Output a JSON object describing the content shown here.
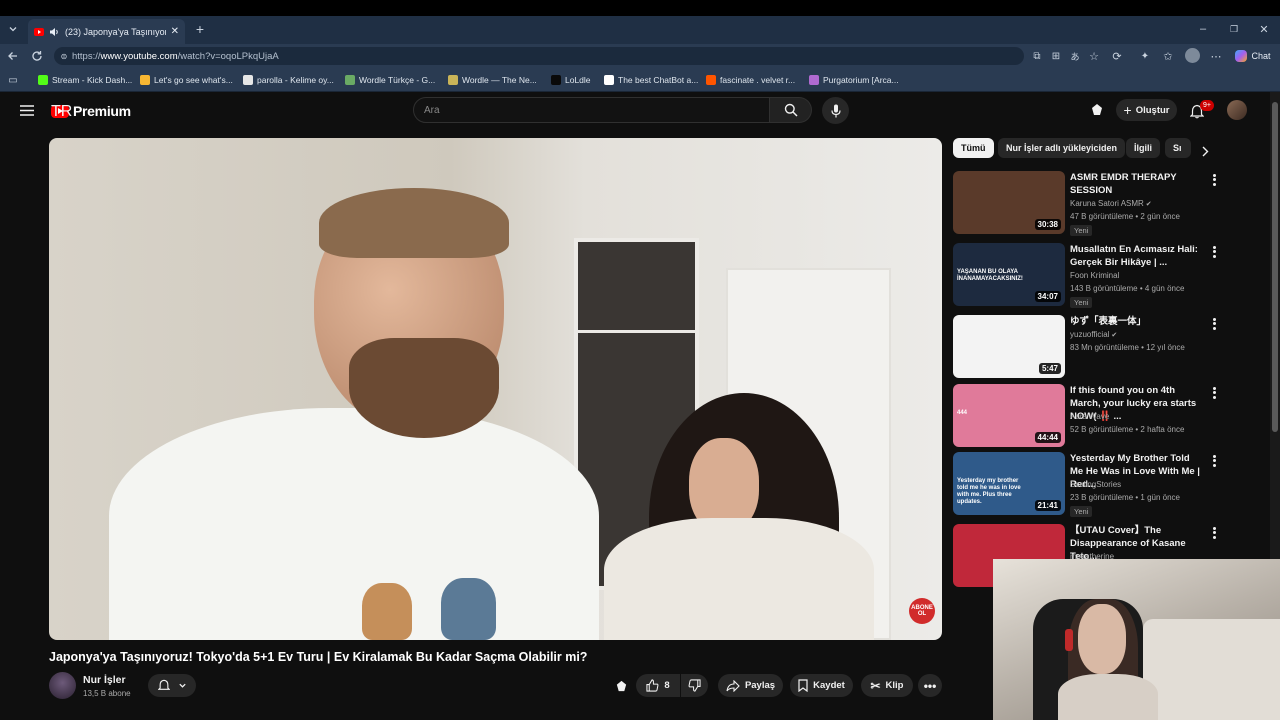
{
  "browser": {
    "tab_title": "(23) Japonya'ya Taşınıyoruz! T",
    "url_prefix": "https://",
    "url_host": "www.youtube.com",
    "url_path": "/watch?v=oqoLPkqUjaA",
    "chat_label": "Chat",
    "bookmarks": [
      {
        "label": "Stream - Kick Dash...",
        "icon": "kick-icon",
        "color": "#53fc18"
      },
      {
        "label": "Let's go see what's...",
        "icon": "smiley-icon",
        "color": "#f7b733"
      },
      {
        "label": "parolla - Kelime oy...",
        "icon": "circle-icon",
        "color": "#e6e6e6"
      },
      {
        "label": "Wordle Türkçe - G...",
        "icon": "wordle-w-icon",
        "color": "#6aaa64"
      },
      {
        "label": "Wordle — The Ne...",
        "icon": "grid-icon",
        "color": "#c9b458"
      },
      {
        "label": "LoLdle",
        "icon": "loldle-icon",
        "color": "#0a0a0a"
      },
      {
        "label": "The best ChatBot a...",
        "icon": "chatbot-icon",
        "color": "#ffffff"
      },
      {
        "label": "fascinate . velvet r...",
        "icon": "soundcloud-icon",
        "color": "#ff5500"
      },
      {
        "label": "Purgatorium [Arca...",
        "icon": "purgatorium-icon",
        "color": "#b06ad0"
      }
    ]
  },
  "youtube": {
    "logo_text": "Premium",
    "logo_region": "TR",
    "search_placeholder": "Ara",
    "create_label": "Oluştur",
    "notification_count": "9+",
    "video": {
      "title": "Japonya'ya Taşınıyoruz! Tokyo'da 5+1 Ev Turu | Ev Kiralamak Bu Kadar Saçma Olabilir mi?",
      "watermark": "ABONE OL",
      "channel_name": "Nur İşler",
      "subscribers": "13,5 B abone",
      "likes": "8",
      "share_label": "Paylaş",
      "save_label": "Kaydet",
      "clip_label": "Klip"
    },
    "chips": [
      "Tümü",
      "Nur İşler adlı yükleyiciden",
      "İlgili",
      "Sı"
    ],
    "recommendations": [
      {
        "title": "ASMR EMDR THERAPY SESSION",
        "channel": "Karuna Satori ASMR",
        "verified": true,
        "meta": "47 B görüntüleme • 2 gün önce",
        "badge": "Yeni",
        "duration": "30:38",
        "thumb_color": "#5a3a2a"
      },
      {
        "title": "Musallatın En Acımasız Hali: Gerçek Bir Hikâye | ...",
        "channel": "Foon Kriminal",
        "verified": false,
        "meta": "143 B görüntüleme • 4 gün önce",
        "badge": "Yeni",
        "duration": "34:07",
        "thumb_color": "#1d2a3f",
        "thumb_text": "YAŞANAN BU OLAYA İNANAMAYACAKSINIZ!"
      },
      {
        "title": "ゆず「表裏一体」",
        "channel": "yuzuofficial",
        "verified": true,
        "meta": "83 Mn görüntüleme • 12 yıl önce",
        "badge": "",
        "duration": "5:47",
        "thumb_color": "#f3f3f3"
      },
      {
        "title": "If this found you on 4th March, your lucky era starts NOW( ‼️ ...",
        "channel": "Aura Wave",
        "verified": false,
        "meta": "52 B görüntüleme • 2 hafta önce",
        "badge": "",
        "duration": "44:44",
        "thumb_color": "#e07a9a",
        "thumb_text": "444"
      },
      {
        "title": "Yesterday My Brother Told Me He Was in Love With Me | Red...",
        "channel": "ScalingStories",
        "verified": false,
        "meta": "23 B görüntüleme • 1 gün önce",
        "badge": "Yeni",
        "duration": "21:41",
        "thumb_color": "#2f5a8a",
        "thumb_text": "Yesterday my brother told me he was in love with me. Plus three updates."
      },
      {
        "title": "【UTAU Cover】The Disappearance of Kasane Teto...",
        "channel": "mokatherine",
        "verified": false,
        "meta": "",
        "badge": "",
        "duration": "",
        "thumb_color": "#c0283a"
      }
    ]
  }
}
